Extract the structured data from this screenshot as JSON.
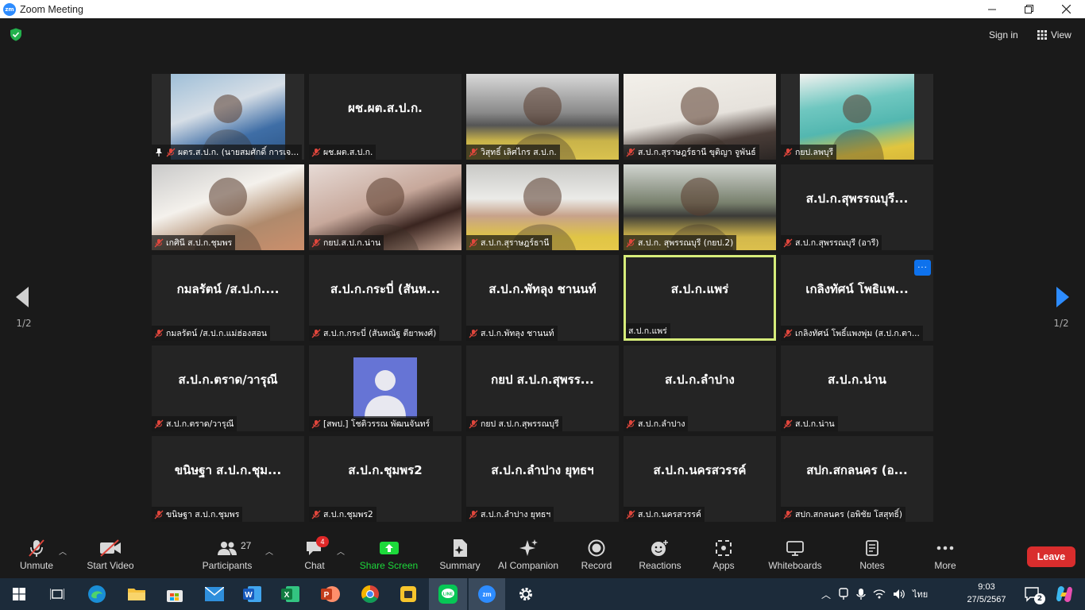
{
  "window": {
    "title": "Zoom Meeting",
    "logo": "zm",
    "controls": [
      "minimize-icon",
      "maximize-icon",
      "close-icon"
    ]
  },
  "topbar": {
    "sign_in": "Sign in",
    "view": "View"
  },
  "pager": {
    "left": "1/2",
    "right": "1/2"
  },
  "tiles": [
    {
      "name": "",
      "label": "ผตร.ส.ป.ก. (นายสมศักดิ์  การเจ...",
      "video": true,
      "pinned": true
    },
    {
      "name": "ผช.ผต.ส.ป.ก.",
      "label": "ผช.ผต.ส.ป.ก.",
      "video": false
    },
    {
      "name": "",
      "label": "วิสุทธิ์  เลิศไกร ส.ป.ก.",
      "video": true
    },
    {
      "name": "",
      "label": "ส.ป.ก.สุราษฎร์ธานี ขุติญา จูพันธ์",
      "video": true
    },
    {
      "name": "",
      "label": "กยป.ลพบุรี",
      "video": true
    },
    {
      "name": "",
      "label": "เกศินี ส.ป.ก.ชุมพร",
      "video": true
    },
    {
      "name": "",
      "label": "กยป.ส.ป.ก.น่าน",
      "video": true
    },
    {
      "name": "",
      "label": "ส.ป.ก.สุราษฎร์ธานี",
      "video": true
    },
    {
      "name": "",
      "label": "ส.ป.ก. สุพรรณบุรี (กยป.2)",
      "video": true
    },
    {
      "name": "ส.ป.ก.สุพรรณบุรี...",
      "label": "ส.ป.ก.สุพรรณบุรี (อารี)",
      "video": false
    },
    {
      "name": "กมลรัตน์ /ส.ป.ก....",
      "label": "กมลรัตน์ /ส.ป.ก.แม่ฮ่องสอน",
      "video": false
    },
    {
      "name": "ส.ป.ก.กระบี่ (สันห...",
      "label": "ส.ป.ก.กระบี่ (สันหณัฐ ตียาพงศ์)",
      "video": false
    },
    {
      "name": "ส.ป.ก.พัทลุง ชานนท์",
      "label": "ส.ป.ก.พัทลุง ชานนท์",
      "video": false
    },
    {
      "name": "ส.ป.ก.แพร่",
      "label": "ส.ป.ก.แพร่",
      "video": false,
      "active": true
    },
    {
      "name": "เกลิงทัศน์ โพธิแพ...",
      "label": "เกลิงทัศน์ โพธิ์แพงพุ่ม (ส.ป.ก.ตา...",
      "video": false,
      "more": "···"
    },
    {
      "name": "ส.ป.ก.ตราด/วารุณี",
      "label": "ส.ป.ก.ตราด/วารุณี",
      "video": false
    },
    {
      "name": "",
      "label": "[สพป.] โชติวรรณ พัฒนจันทร์",
      "video": false,
      "avatar": true
    },
    {
      "name": "กยป ส.ป.ก.สุพรร...",
      "label": "กยป ส.ป.ก.สุพรรณบุรี",
      "video": false
    },
    {
      "name": "ส.ป.ก.ลำปาง",
      "label": "ส.ป.ก.ลำปาง",
      "video": false
    },
    {
      "name": "ส.ป.ก.น่าน",
      "label": "ส.ป.ก.น่าน",
      "video": false
    },
    {
      "name": "ขนิษฐา ส.ป.ก.ชุม...",
      "label": "ขนิษฐา ส.ป.ก.ชุมพร",
      "video": false
    },
    {
      "name": "ส.ป.ก.ชุมพร2",
      "label": "ส.ป.ก.ชุมพร2",
      "video": false
    },
    {
      "name": "ส.ป.ก.ลำปาง ยุทธฯ",
      "label": "ส.ป.ก.ลำปาง ยุทธฯ",
      "video": false
    },
    {
      "name": "ส.ป.ก.นครสวรรค์",
      "label": "ส.ป.ก.นครสวรรค์",
      "video": false
    },
    {
      "name": "สปก.สกลนคร (อ...",
      "label": "สปก.สกลนคร (อพิชัย  โสสุทธิ์)",
      "video": false
    }
  ],
  "toolbar": {
    "unmute": "Unmute",
    "start_video": "Start Video",
    "participants": "Participants",
    "participants_count": "27",
    "chat": "Chat",
    "chat_badge": "4",
    "share": "Share Screen",
    "summary": "Summary",
    "ai": "AI Companion",
    "record": "Record",
    "reactions": "Reactions",
    "apps": "Apps",
    "whiteboards": "Whiteboards",
    "notes": "Notes",
    "more": "More",
    "leave": "Leave"
  },
  "colors": {
    "share_green": "#1dd93b",
    "leave_red": "#d92d2d",
    "active_border": "#d6ec7a",
    "mic_red": "#e0463c"
  },
  "taskbar": {
    "apps": [
      "windows-start-icon",
      "task-view-icon",
      "edge-icon",
      "file-explorer-icon",
      "store-icon",
      "mail-icon",
      "word-icon",
      "excel-icon",
      "powerpoint-icon",
      "chrome-icon",
      "sticky-app-icon",
      "line-icon",
      "zoom-icon",
      "settings-icon"
    ],
    "language": "ไทย",
    "time": "9:03",
    "date": "27/5/2567",
    "notifications": "2"
  }
}
